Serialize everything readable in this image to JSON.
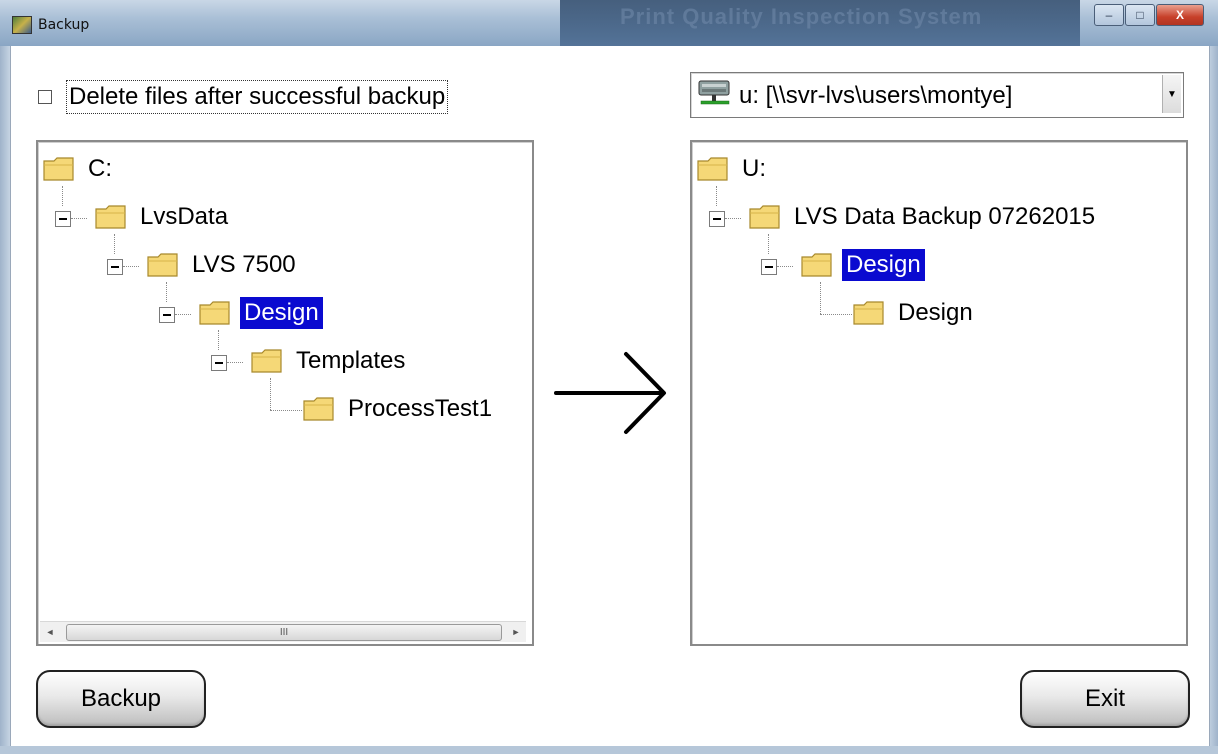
{
  "window": {
    "title": "Backup",
    "background_title_text": "Print Quality Inspection System",
    "controls": {
      "minimize": "–",
      "maximize": "□",
      "close": "X"
    }
  },
  "options": {
    "delete_after_backup_label": "Delete files after successful backup",
    "delete_after_backup_checked": false
  },
  "destination": {
    "drive_label": "u: [\\\\svr-lvs\\users\\montye]",
    "dropdown_arrow": "▼"
  },
  "source_tree": {
    "nodes": [
      {
        "label": "C:",
        "level": 0,
        "selected": false
      },
      {
        "label": "LvsData",
        "level": 1,
        "selected": false
      },
      {
        "label": "LVS 7500",
        "level": 2,
        "selected": false
      },
      {
        "label": "Design",
        "level": 3,
        "selected": true
      },
      {
        "label": "Templates",
        "level": 4,
        "selected": false
      },
      {
        "label": "ProcessTest1",
        "level": 5,
        "selected": false
      }
    ],
    "scrollbar": {
      "left_arrow": "◄",
      "right_arrow": "►",
      "grip": "III"
    }
  },
  "dest_tree": {
    "nodes": [
      {
        "label": "U:",
        "level": 0,
        "selected": false
      },
      {
        "label": "LVS Data Backup 07262015",
        "level": 1,
        "selected": false
      },
      {
        "label": "Design",
        "level": 2,
        "selected": true
      },
      {
        "label": "Design",
        "level": 3,
        "selected": false
      }
    ]
  },
  "buttons": {
    "backup_label": "Backup",
    "exit_label": "Exit"
  },
  "colors": {
    "selection_bg": "#0a0ad0",
    "folder_fill": "#f5d877"
  },
  "icons": [
    "app-icon",
    "folder-icon",
    "network-drive-icon",
    "expander-icon",
    "arrow-right-icon"
  ]
}
